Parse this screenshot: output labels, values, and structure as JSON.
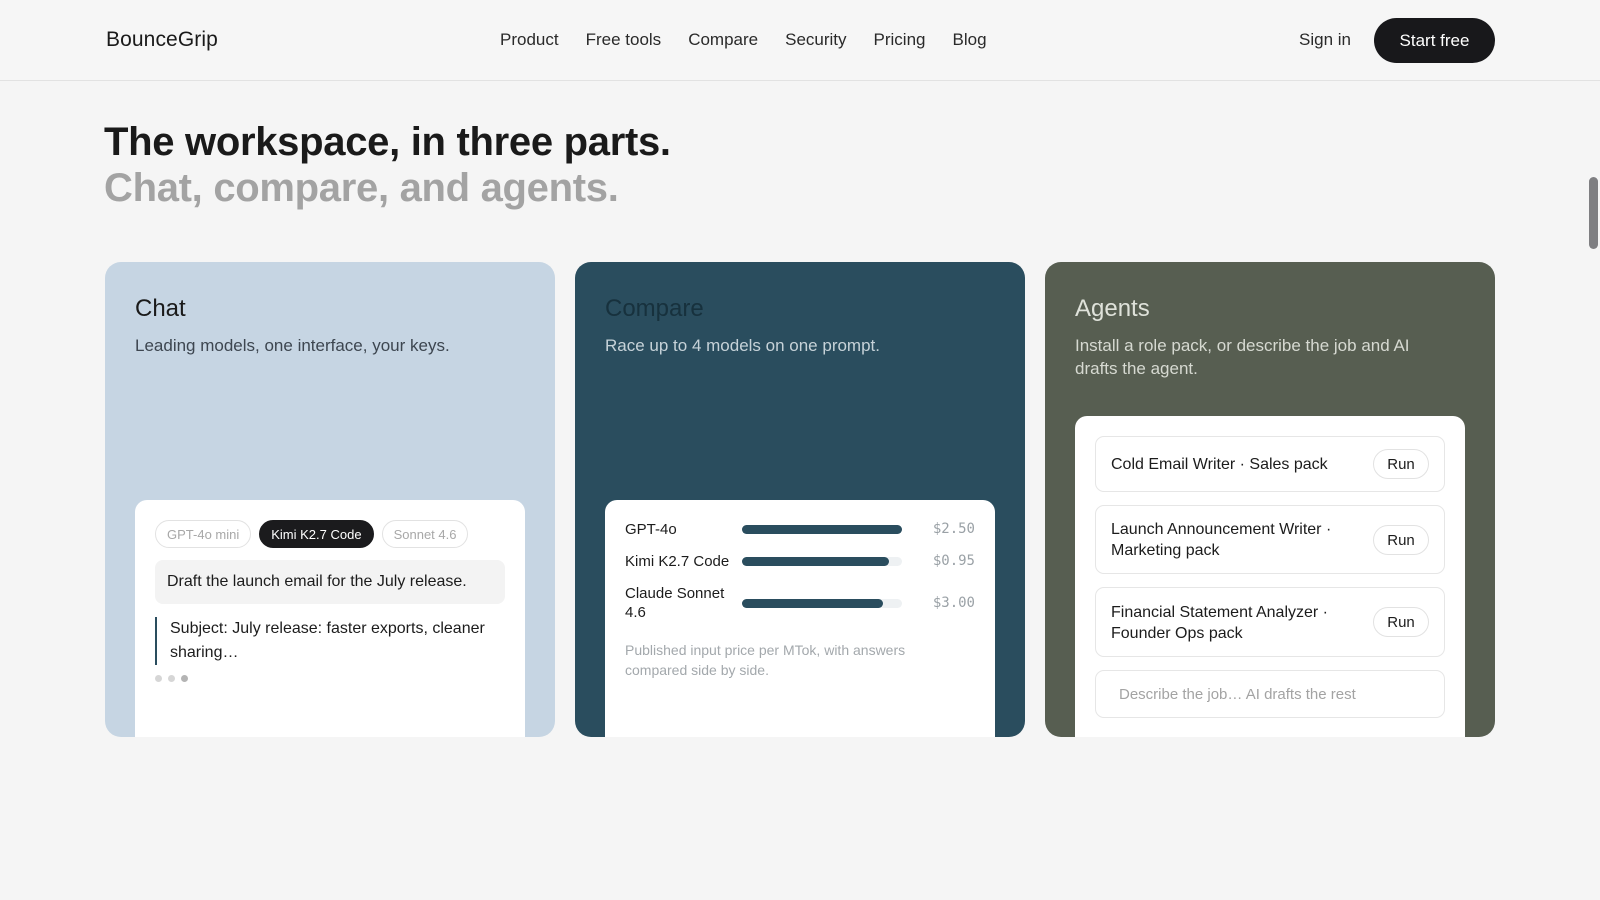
{
  "header": {
    "logo": "BounceGrip",
    "nav": [
      "Product",
      "Free tools",
      "Compare",
      "Security",
      "Pricing",
      "Blog"
    ],
    "sign_in": "Sign in",
    "cta": "Start free"
  },
  "hero": {
    "title": "The workspace, in three parts.",
    "subtitle": "Chat, compare, and agents."
  },
  "cards": {
    "chat": {
      "title": "Chat",
      "description": "Leading models, one interface, your keys.",
      "models": [
        "GPT-4o mini",
        "Kimi K2.7 Code",
        "Sonnet 4.6"
      ],
      "active_model": "Kimi K2.7 Code",
      "prompt": "Draft the launch email for the July release.",
      "response": "Subject: July release: faster exports, cleaner sharing…"
    },
    "compare": {
      "title": "Compare",
      "description": "Race up to 4 models on one prompt.",
      "rows": [
        {
          "model": "GPT-4o",
          "price": "$2.50",
          "fill": 1.0
        },
        {
          "model": "Kimi K2.7 Code",
          "price": "$0.95",
          "fill": 0.92
        },
        {
          "model": "Claude Sonnet 4.6",
          "price": "$3.00",
          "fill": 0.88
        }
      ],
      "note": "Published input price per MTok, with answers compared side by side."
    },
    "agents": {
      "title": "Agents",
      "description": "Install a role pack, or describe the job and AI drafts the agent.",
      "items": [
        {
          "label": "Cold Email Writer · Sales pack",
          "action": "Run"
        },
        {
          "label": "Launch Announcement Writer · Marketing pack",
          "action": "Run"
        },
        {
          "label": "Financial Statement Analyzer · Founder Ops pack",
          "action": "Run"
        }
      ],
      "input_placeholder": "Describe the job… AI drafts the rest"
    }
  },
  "colors": {
    "chat_bg": "#c6d5e3",
    "compare_bg": "#2a4d5e",
    "agents_bg": "#575e51",
    "cta_bg": "#18181b"
  }
}
